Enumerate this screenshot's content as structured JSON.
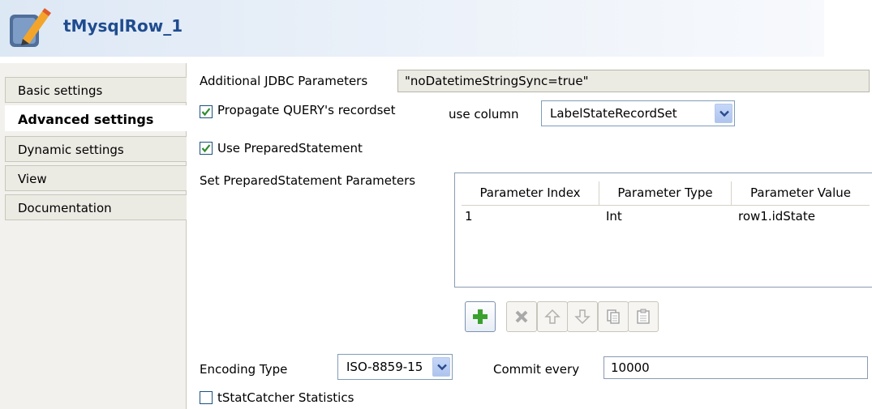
{
  "header": {
    "title": "tMysqlRow_1",
    "icon": "component-pencil-icon"
  },
  "sidebar": {
    "tabs": [
      {
        "label": "Basic settings",
        "active": false
      },
      {
        "label": "Advanced settings",
        "active": true
      },
      {
        "label": "Dynamic settings",
        "active": false
      },
      {
        "label": "View",
        "active": false
      },
      {
        "label": "Documentation",
        "active": false
      }
    ]
  },
  "form": {
    "jdbc": {
      "label": "Additional JDBC Parameters",
      "value": "\"noDatetimeStringSync=true\""
    },
    "propagate": {
      "label": "Propagate QUERY's recordset",
      "checked": true
    },
    "use_column": {
      "label": "use column",
      "value": "LabelStateRecordSet"
    },
    "use_prepared": {
      "label": "Use PreparedStatement",
      "checked": true
    },
    "prepared_params": {
      "label": "Set PreparedStatement Parameters",
      "columns": [
        "Parameter Index",
        "Parameter Type",
        "Parameter Value"
      ],
      "rows": [
        [
          "1",
          "Int",
          "row1.idState"
        ]
      ]
    },
    "toolbar": {
      "buttons": [
        {
          "name": "add-icon",
          "enabled": true
        },
        {
          "name": "delete-icon",
          "enabled": false
        },
        {
          "name": "move-up-icon",
          "enabled": false
        },
        {
          "name": "move-down-icon",
          "enabled": false
        },
        {
          "name": "copy-icon",
          "enabled": false
        },
        {
          "name": "paste-icon",
          "enabled": false
        }
      ]
    },
    "encoding": {
      "label": "Encoding Type",
      "value": "ISO-8859-15"
    },
    "commit": {
      "label": "Commit every",
      "value": "10000"
    },
    "tstat": {
      "label": "tStatCatcher Statistics",
      "checked": false
    }
  },
  "colors": {
    "title": "#1f4c8f",
    "add_green": "#3aa12f",
    "check": "#2e8b2e"
  }
}
